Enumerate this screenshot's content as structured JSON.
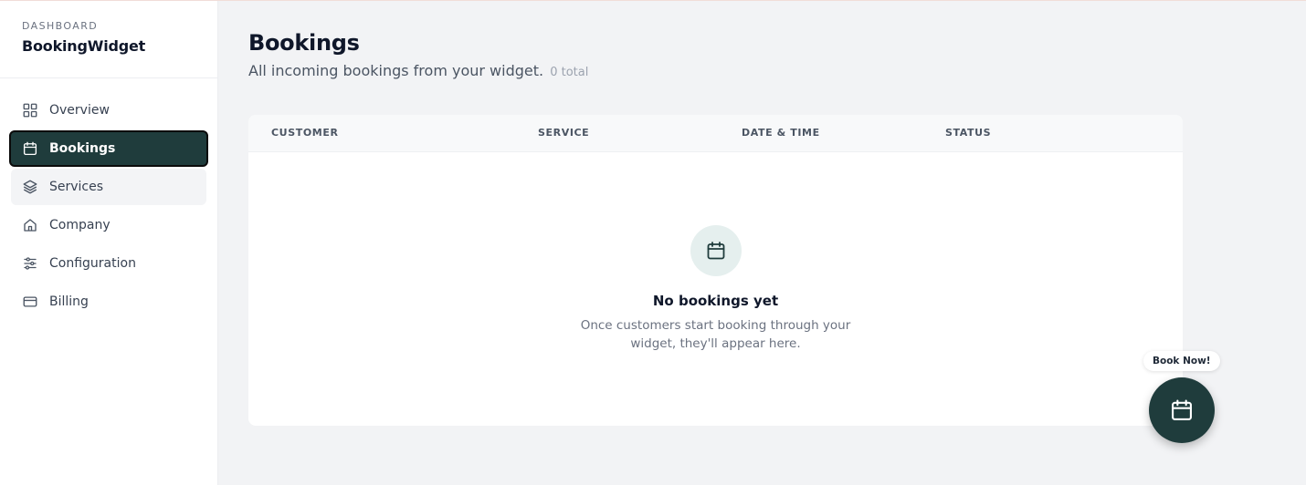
{
  "sidebar": {
    "eyebrow": "DASHBOARD",
    "app_name": "BookingWidget",
    "items": [
      {
        "label": "Overview",
        "icon": "grid-icon"
      },
      {
        "label": "Bookings",
        "icon": "calendar-icon",
        "active": true
      },
      {
        "label": "Services",
        "icon": "layers-icon"
      },
      {
        "label": "Company",
        "icon": "home-icon"
      },
      {
        "label": "Configuration",
        "icon": "sliders-icon"
      },
      {
        "label": "Billing",
        "icon": "credit-card-icon"
      }
    ]
  },
  "main": {
    "title": "Bookings",
    "subtitle": "All incoming bookings from your widget.",
    "count": "0 total",
    "table": {
      "columns": [
        "CUSTOMER",
        "SERVICE",
        "DATE & TIME",
        "STATUS"
      ]
    },
    "empty": {
      "icon": "calendar-icon",
      "title": "No bookings yet",
      "text": "Once customers start booking through your widget, they'll appear here."
    }
  },
  "widget": {
    "label": "Book Now!",
    "icon": "calendar-icon"
  },
  "colors": {
    "accent": "#1f3c3c",
    "background": "#f2f3f5",
    "empty_icon_bg": "#e5efee"
  }
}
